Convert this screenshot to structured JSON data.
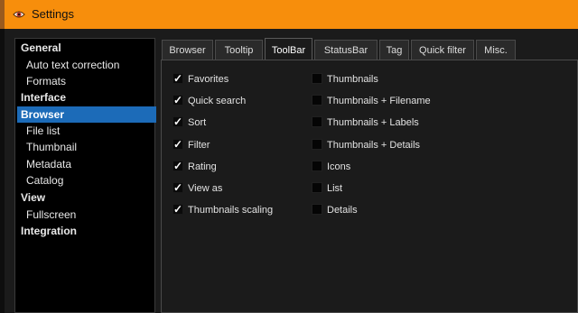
{
  "window": {
    "title": "Settings",
    "icon": "eye-logo-icon",
    "accent_color": "#f78e0c"
  },
  "sidebar": {
    "items": [
      {
        "label": "General",
        "kind": "section",
        "selected": false
      },
      {
        "label": "Auto text correction",
        "kind": "child",
        "selected": false
      },
      {
        "label": "Formats",
        "kind": "child",
        "selected": false
      },
      {
        "label": "Interface",
        "kind": "section",
        "selected": false
      },
      {
        "label": "Browser",
        "kind": "section",
        "selected": true
      },
      {
        "label": "File list",
        "kind": "child",
        "selected": false
      },
      {
        "label": "Thumbnail",
        "kind": "child",
        "selected": false
      },
      {
        "label": "Metadata",
        "kind": "child",
        "selected": false
      },
      {
        "label": "Catalog",
        "kind": "child",
        "selected": false
      },
      {
        "label": "View",
        "kind": "section",
        "selected": false
      },
      {
        "label": "Fullscreen",
        "kind": "child",
        "selected": false
      },
      {
        "label": "Integration",
        "kind": "section",
        "selected": false
      }
    ],
    "selected_color": "#1c6bb8"
  },
  "tabs": [
    {
      "label": "Browser",
      "active": false
    },
    {
      "label": "Tooltip",
      "active": false
    },
    {
      "label": "ToolBar",
      "active": true
    },
    {
      "label": "StatusBar",
      "active": false
    },
    {
      "label": "Tag",
      "active": false
    },
    {
      "label": "Quick filter",
      "active": false
    },
    {
      "label": "Misc.",
      "active": false
    }
  ],
  "toolbar_options": {
    "left": [
      {
        "label": "Favorites",
        "checked": true
      },
      {
        "label": "Quick search",
        "checked": true
      },
      {
        "label": "Sort",
        "checked": true
      },
      {
        "label": "Filter",
        "checked": true
      },
      {
        "label": "Rating",
        "checked": true
      },
      {
        "label": "View as",
        "checked": true
      },
      {
        "label": "Thumbnails scaling",
        "checked": true
      }
    ],
    "right": [
      {
        "label": "Thumbnails",
        "checked": false
      },
      {
        "label": "Thumbnails + Filename",
        "checked": false
      },
      {
        "label": "Thumbnails + Labels",
        "checked": false
      },
      {
        "label": "Thumbnails + Details",
        "checked": false
      },
      {
        "label": "Icons",
        "checked": false
      },
      {
        "label": "List",
        "checked": false
      },
      {
        "label": "Details",
        "checked": false
      }
    ]
  }
}
